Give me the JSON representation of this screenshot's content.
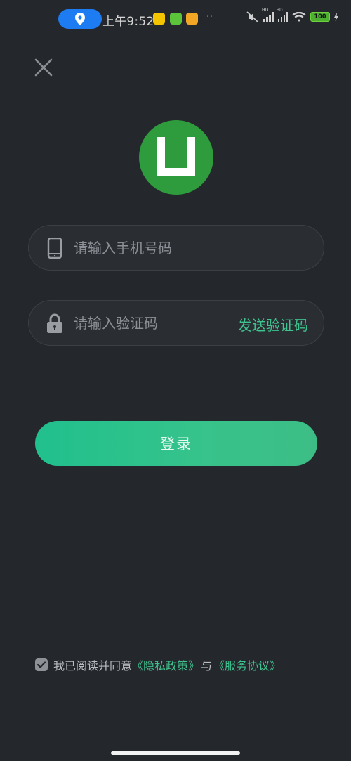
{
  "status_bar": {
    "time": "上午9:52",
    "battery": "100",
    "more": "··",
    "signal_hd_label": "HD"
  },
  "colors": {
    "background": "#24272b",
    "accent": "#3fc38f",
    "logo_bg": "#2e9b3c",
    "location_pill": "#1e7cf2"
  },
  "icons": {
    "close": "close-icon",
    "logo": "app-logo-icon",
    "phone": "mobile-phone-icon",
    "lock": "lock-icon",
    "check": "check-icon"
  },
  "form": {
    "phone_placeholder": "请输入手机号码",
    "code_placeholder": "请输入验证码",
    "send_code_label": "发送验证码",
    "login_label": "登录"
  },
  "agreement": {
    "prefix": "我已阅读并同意",
    "privacy_link": "《隐私政策》",
    "conjunction": "与",
    "service_link": "《服务协议》",
    "checked": true
  }
}
